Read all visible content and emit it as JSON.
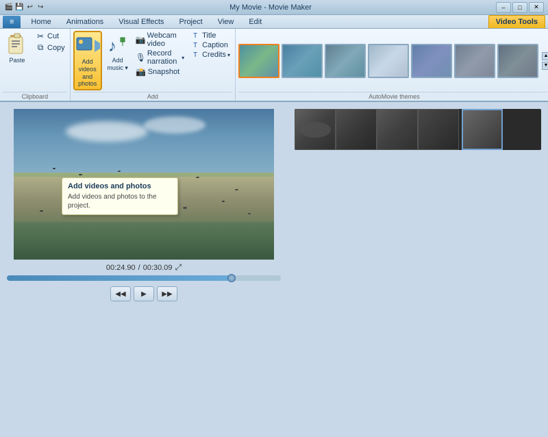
{
  "titlebar": {
    "text": "My Movie - Movie Maker",
    "min_label": "–",
    "max_label": "□",
    "close_label": "✕"
  },
  "quickaccess": {
    "buttons": [
      "💾",
      "↩",
      "↪"
    ]
  },
  "tabs": {
    "items": [
      "Home",
      "Animations",
      "Visual Effects",
      "Project",
      "View",
      "Edit"
    ],
    "video_tools_label": "Video Tools"
  },
  "ribbon": {
    "groups": {
      "clipboard": {
        "label": "Clipboard",
        "paste": "Paste",
        "cut": "Cut",
        "copy": "Copy"
      },
      "add": {
        "label": "Add",
        "add_videos_label": "Add videos\nand photos",
        "add_music_label": "Add\nmusic",
        "webcam_label": "Webcam video",
        "narration_label": "Record narration",
        "snapshot_label": "Snapshot",
        "title_label": "Title",
        "caption_label": "Caption",
        "credits_label": "Credits"
      },
      "themes": {
        "label": "AutoMovie themes",
        "scroll_up": "▲",
        "scroll_down": "▼"
      }
    }
  },
  "tooltip": {
    "title": "Add videos and photos",
    "description": "Add videos and photos to the project."
  },
  "player": {
    "time_current": "00:24.90",
    "time_total": "00:30.09",
    "fullscreen_label": "⤢",
    "prev_label": "◀◀",
    "play_label": "▶",
    "next_label": "▶▶"
  },
  "themes": [
    {
      "color1": "#4a8090",
      "color2": "#6aaa88",
      "label": "theme1",
      "selected": true
    },
    {
      "color1": "#5090a0",
      "color2": "#70b0a0",
      "label": "theme2"
    },
    {
      "color1": "#608090",
      "color2": "#80a090",
      "label": "theme3"
    },
    {
      "color1": "#7090a0",
      "color2": "#90b0a0",
      "label": "theme4"
    },
    {
      "color1": "#6080a0",
      "color2": "#8090b0",
      "label": "theme5"
    },
    {
      "color1": "#708090",
      "color2": "#90a0b0",
      "label": "theme6"
    },
    {
      "color1": "#607080",
      "color2": "#8090a0",
      "label": "theme7"
    }
  ]
}
